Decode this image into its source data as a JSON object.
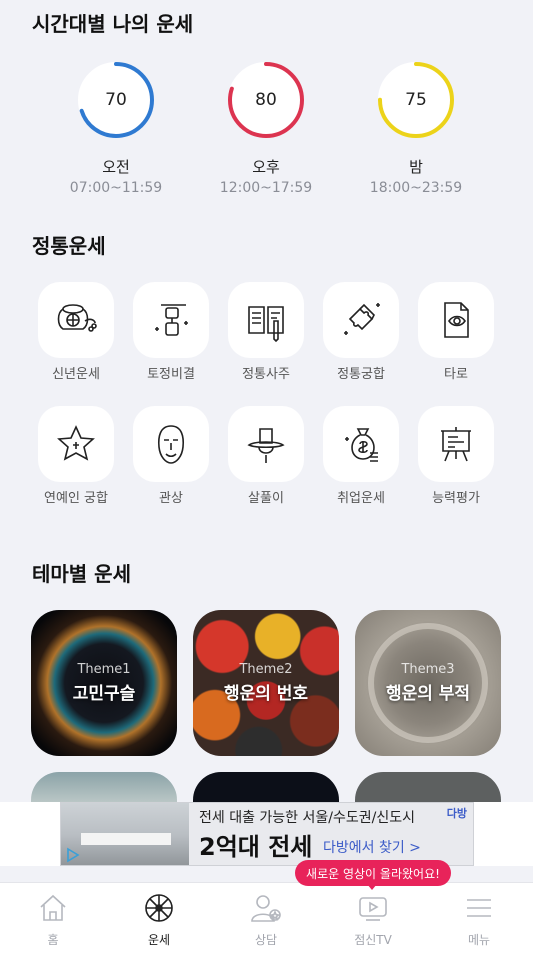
{
  "sections": {
    "time_fortune": "시간대별 나의 운세",
    "traditional": "정통운세",
    "theme": "테마별 운세"
  },
  "gauges": [
    {
      "score": "70",
      "label": "오전",
      "time": "07:00~11:59",
      "color": "#2f7ad1",
      "fraction": 0.7
    },
    {
      "score": "80",
      "label": "오후",
      "time": "12:00~17:59",
      "color": "#dc3450",
      "fraction": 0.8
    },
    {
      "score": "75",
      "label": "밤",
      "time": "18:00~23:59",
      "color": "#ecd31a",
      "fraction": 0.75
    }
  ],
  "tiles": [
    {
      "label": "신년운세",
      "icon": "fortune-pot-icon"
    },
    {
      "label": "토정비결",
      "icon": "hourglass-icon"
    },
    {
      "label": "정통사주",
      "icon": "book-pen-icon"
    },
    {
      "label": "정통궁합",
      "icon": "puzzle-icon"
    },
    {
      "label": "타로",
      "icon": "tarot-eye-icon"
    },
    {
      "label": "연예인 궁합",
      "icon": "star-icon"
    },
    {
      "label": "관상",
      "icon": "face-mask-icon"
    },
    {
      "label": "살풀이",
      "icon": "gat-hat-icon"
    },
    {
      "label": "취업운세",
      "icon": "money-bag-icon"
    },
    {
      "label": "능력평가",
      "icon": "presentation-board-icon"
    }
  ],
  "themes": [
    {
      "sub": "Theme1",
      "title": "고민구슬"
    },
    {
      "sub": "Theme2",
      "title": "행운의 번호"
    },
    {
      "sub": "Theme3",
      "title": "행운의 부적"
    }
  ],
  "ad": {
    "line1": "전세 대출 가능한 서울/수도권/신도시",
    "line2": "2억대 전세",
    "cta": "다방에서 찾기 >",
    "logo": "다방"
  },
  "notification": "새로운 영상이 올라왔어요!",
  "nav": [
    {
      "label": "홈",
      "icon": "home-icon",
      "active": false
    },
    {
      "label": "운세",
      "icon": "wheel-icon",
      "active": true
    },
    {
      "label": "상담",
      "icon": "counselor-icon",
      "active": false
    },
    {
      "label": "점신TV",
      "icon": "tv-icon",
      "active": false
    },
    {
      "label": "메뉴",
      "icon": "menu-icon",
      "active": false
    }
  ]
}
